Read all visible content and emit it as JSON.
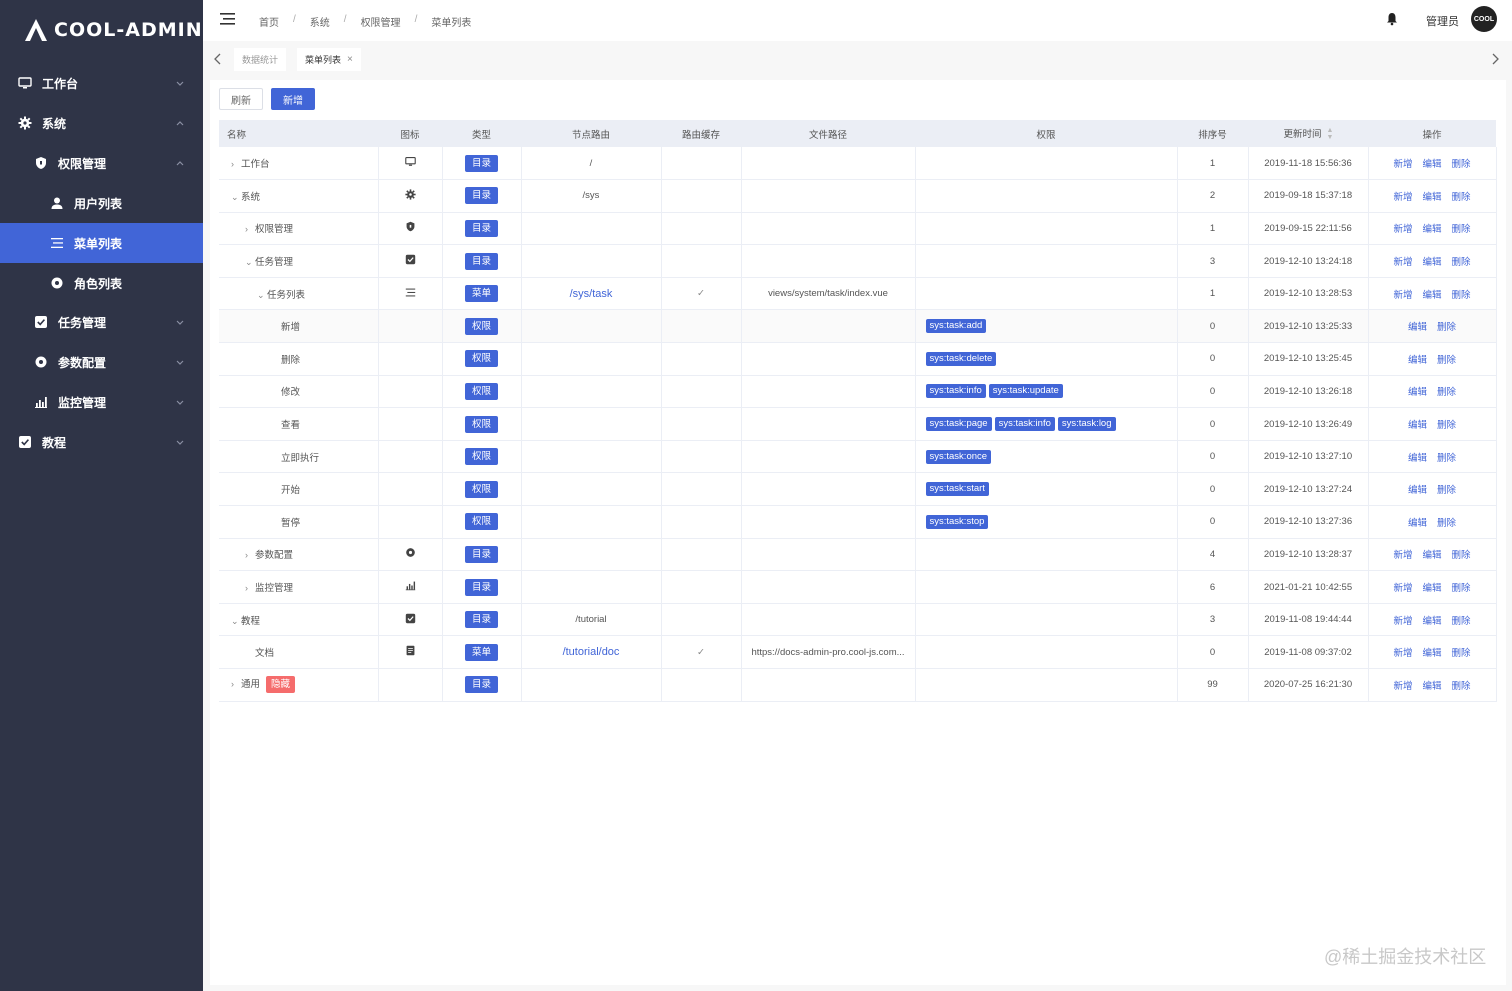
{
  "app": {
    "logo_text": "COOL-ADMIN"
  },
  "sidebar": {
    "items": [
      {
        "label": "工作台",
        "icon": "monitor-icon"
      },
      {
        "label": "系统",
        "icon": "gear-icon"
      },
      {
        "label": "权限管理",
        "icon": "shield-icon"
      },
      {
        "label": "用户列表",
        "icon": "user-icon"
      },
      {
        "label": "菜单列表",
        "icon": "menu-list-icon",
        "active": true
      },
      {
        "label": "角色列表",
        "icon": "role-icon"
      },
      {
        "label": "任务管理",
        "icon": "task-check-icon"
      },
      {
        "label": "参数配置",
        "icon": "param-icon"
      },
      {
        "label": "监控管理",
        "icon": "chart-icon"
      },
      {
        "label": "教程",
        "icon": "tutorial-check-icon"
      }
    ]
  },
  "header": {
    "breadcrumb": [
      "首页",
      "系统",
      "权限管理",
      "菜单列表"
    ],
    "separator": "/",
    "username": "管理员",
    "avatar_text": "COOL"
  },
  "tabs": [
    {
      "label": "数据统计",
      "active": false
    },
    {
      "label": "菜单列表",
      "active": true,
      "close": "×"
    }
  ],
  "toolbar": {
    "refresh_label": "刷新",
    "add_label": "新增"
  },
  "table": {
    "columns": [
      "名称",
      "图标",
      "类型",
      "节点路由",
      "路由缓存",
      "文件路径",
      "权限",
      "排序号",
      "更新时间",
      "操作"
    ],
    "rows": [
      {
        "arrow": "›",
        "level": 0,
        "name": "工作台",
        "icon": "monitor-icon",
        "type": "目录",
        "route": "/",
        "route_link": false,
        "cache": "",
        "file": "",
        "perms": [],
        "sort": "1",
        "time": "2019-11-18 15:56:36",
        "ops": [
          "新增",
          "编辑",
          "删除"
        ]
      },
      {
        "arrow": "⌄",
        "level": 0,
        "name": "系统",
        "icon": "gear-icon",
        "type": "目录",
        "route": "/sys",
        "route_link": false,
        "cache": "",
        "file": "",
        "perms": [],
        "sort": "2",
        "time": "2019-09-18 15:37:18",
        "ops": [
          "新增",
          "编辑",
          "删除"
        ]
      },
      {
        "arrow": "›",
        "level": 1,
        "name": "权限管理",
        "icon": "shield-icon",
        "type": "目录",
        "route": "",
        "route_link": false,
        "cache": "",
        "file": "",
        "perms": [],
        "sort": "1",
        "time": "2019-09-15 22:11:56",
        "ops": [
          "新增",
          "编辑",
          "删除"
        ]
      },
      {
        "arrow": "⌄",
        "level": 1,
        "name": "任务管理",
        "icon": "task-check-icon",
        "type": "目录",
        "route": "",
        "route_link": false,
        "cache": "",
        "file": "",
        "perms": [],
        "sort": "3",
        "time": "2019-12-10 13:24:18",
        "ops": [
          "新增",
          "编辑",
          "删除"
        ]
      },
      {
        "arrow": "⌄",
        "level": 2,
        "name": "任务列表",
        "icon": "menu-list-icon",
        "type": "菜单",
        "route": "/sys/task",
        "route_link": true,
        "cache": "✓",
        "file": "views/system/task/index.vue",
        "perms": [],
        "sort": "1",
        "time": "2019-12-10 13:28:53",
        "ops": [
          "新增",
          "编辑",
          "删除"
        ]
      },
      {
        "arrow": "",
        "level": 3,
        "name": "新增",
        "icon": "",
        "type": "权限",
        "route": "",
        "route_link": false,
        "cache": "",
        "file": "",
        "perms": [
          "sys:task:add"
        ],
        "sort": "0",
        "time": "2019-12-10 13:25:33",
        "ops": [
          "编辑",
          "删除"
        ],
        "alt": true
      },
      {
        "arrow": "",
        "level": 3,
        "name": "删除",
        "icon": "",
        "type": "权限",
        "route": "",
        "route_link": false,
        "cache": "",
        "file": "",
        "perms": [
          "sys:task:delete"
        ],
        "sort": "0",
        "time": "2019-12-10 13:25:45",
        "ops": [
          "编辑",
          "删除"
        ]
      },
      {
        "arrow": "",
        "level": 3,
        "name": "修改",
        "icon": "",
        "type": "权限",
        "route": "",
        "route_link": false,
        "cache": "",
        "file": "",
        "perms": [
          "sys:task:info",
          "sys:task:update"
        ],
        "sort": "0",
        "time": "2019-12-10 13:26:18",
        "ops": [
          "编辑",
          "删除"
        ]
      },
      {
        "arrow": "",
        "level": 3,
        "name": "查看",
        "icon": "",
        "type": "权限",
        "route": "",
        "route_link": false,
        "cache": "",
        "file": "",
        "perms": [
          "sys:task:page",
          "sys:task:info",
          "sys:task:log"
        ],
        "sort": "0",
        "time": "2019-12-10 13:26:49",
        "ops": [
          "编辑",
          "删除"
        ]
      },
      {
        "arrow": "",
        "level": 3,
        "name": "立即执行",
        "icon": "",
        "type": "权限",
        "route": "",
        "route_link": false,
        "cache": "",
        "file": "",
        "perms": [
          "sys:task:once"
        ],
        "sort": "0",
        "time": "2019-12-10 13:27:10",
        "ops": [
          "编辑",
          "删除"
        ]
      },
      {
        "arrow": "",
        "level": 3,
        "name": "开始",
        "icon": "",
        "type": "权限",
        "route": "",
        "route_link": false,
        "cache": "",
        "file": "",
        "perms": [
          "sys:task:start"
        ],
        "sort": "0",
        "time": "2019-12-10 13:27:24",
        "ops": [
          "编辑",
          "删除"
        ]
      },
      {
        "arrow": "",
        "level": 3,
        "name": "暂停",
        "icon": "",
        "type": "权限",
        "route": "",
        "route_link": false,
        "cache": "",
        "file": "",
        "perms": [
          "sys:task:stop"
        ],
        "sort": "0",
        "time": "2019-12-10 13:27:36",
        "ops": [
          "编辑",
          "删除"
        ]
      },
      {
        "arrow": "›",
        "level": 1,
        "name": "参数配置",
        "icon": "param-icon",
        "type": "目录",
        "route": "",
        "route_link": false,
        "cache": "",
        "file": "",
        "perms": [],
        "sort": "4",
        "time": "2019-12-10 13:28:37",
        "ops": [
          "新增",
          "编辑",
          "删除"
        ]
      },
      {
        "arrow": "›",
        "level": 1,
        "name": "监控管理",
        "icon": "chart-icon",
        "type": "目录",
        "route": "",
        "route_link": false,
        "cache": "",
        "file": "",
        "perms": [],
        "sort": "6",
        "time": "2021-01-21 10:42:55",
        "ops": [
          "新增",
          "编辑",
          "删除"
        ]
      },
      {
        "arrow": "⌄",
        "level": 0,
        "name": "教程",
        "icon": "tutorial-check-icon",
        "type": "目录",
        "route": "/tutorial",
        "route_link": false,
        "cache": "",
        "file": "",
        "perms": [],
        "sort": "3",
        "time": "2019-11-08 19:44:44",
        "ops": [
          "新增",
          "编辑",
          "删除"
        ]
      },
      {
        "arrow": "",
        "level": 1,
        "name": "文档",
        "icon": "doc-icon",
        "type": "菜单",
        "route": "/tutorial/doc",
        "route_link": true,
        "cache": "✓",
        "file": "https://docs-admin-pro.cool-js.com...",
        "perms": [],
        "sort": "0",
        "time": "2019-11-08 09:37:02",
        "ops": [
          "新增",
          "编辑",
          "删除"
        ]
      },
      {
        "arrow": "›",
        "level": 0,
        "name": "通用",
        "icon": "",
        "badge": "隐藏",
        "type": "目录",
        "route": "",
        "route_link": false,
        "cache": "",
        "file": "",
        "perms": [],
        "sort": "99",
        "time": "2020-07-25 16:21:30",
        "ops": [
          "新增",
          "编辑",
          "删除"
        ]
      }
    ]
  },
  "watermark": "@稀土掘金技术社区",
  "colors": {
    "sidebar_bg": "#2f3447",
    "accent": "#4165d7",
    "danger": "#f56c6c"
  }
}
